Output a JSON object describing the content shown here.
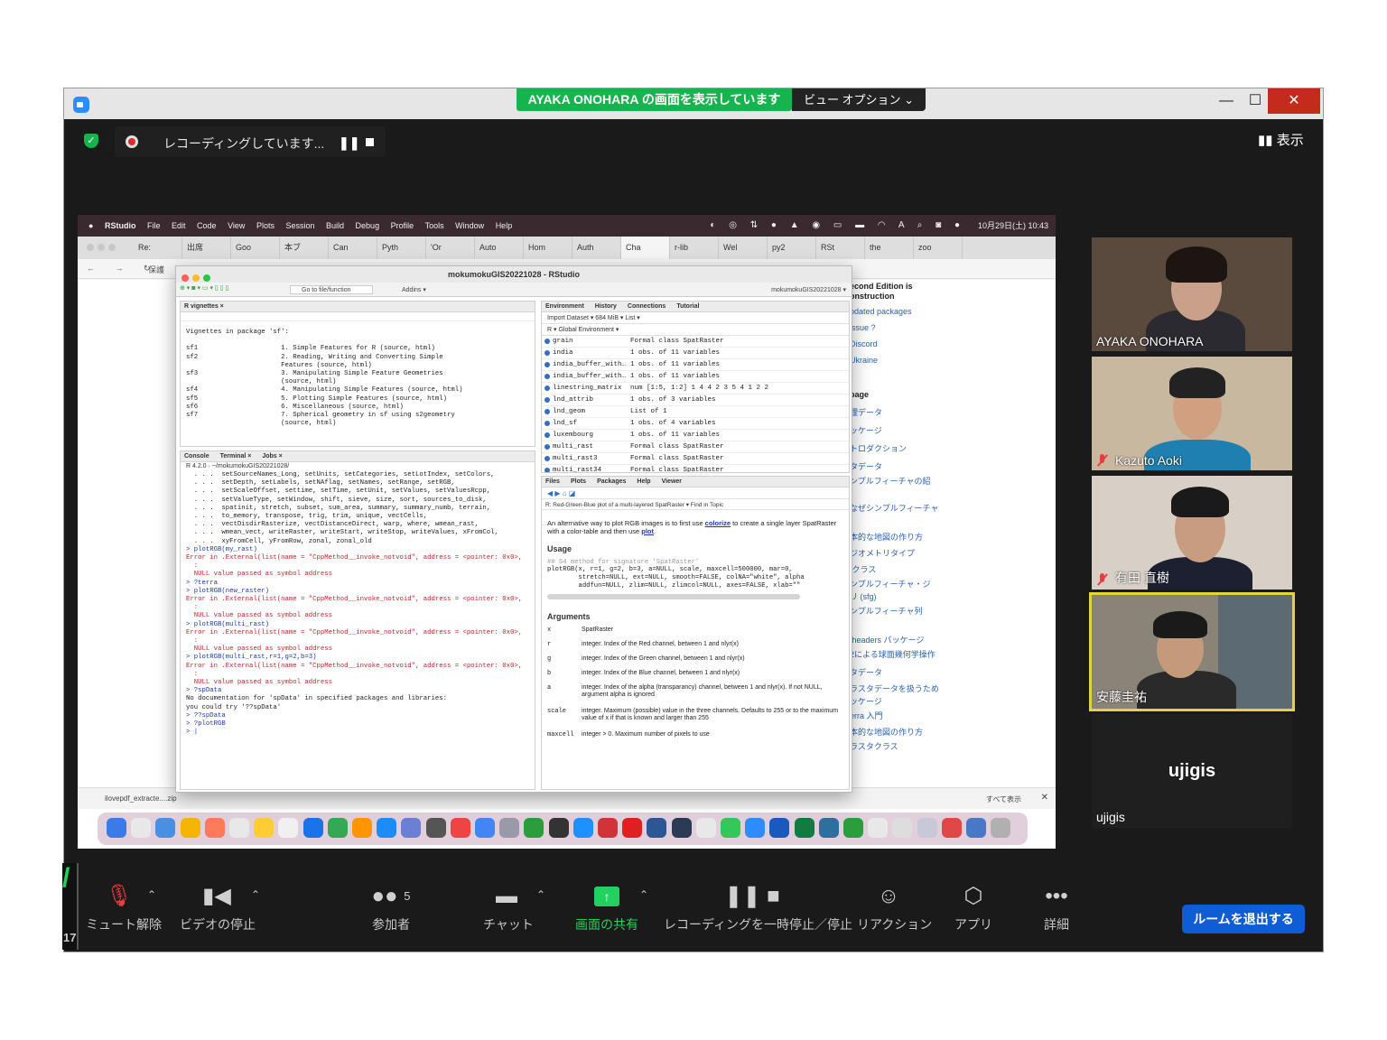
{
  "zoom": {
    "sharing_banner": "AYAKA ONOHARA の画面を表示しています",
    "view_options": "ビュー オプション ⌄",
    "minimize": "—",
    "maximize": "☐",
    "close": "✕",
    "recording_text": "レコーディングしています...",
    "view_toggle": "表示",
    "left_stub_num": "17",
    "left_stub_mark": "/",
    "controls": {
      "mute": "ミュート解除",
      "video": "ビデオの停止",
      "participants": "参加者",
      "participants_count": "5",
      "chat": "チャット",
      "share": "画面の共有",
      "recording": "レコーディングを一時停止／停止",
      "reactions": "リアクション",
      "apps": "アプリ",
      "more": "詳細",
      "leave": "ルームを退出する"
    },
    "participants": [
      {
        "name": "AYAKA ONOHARA",
        "muted": false
      },
      {
        "name": "Kazuto Aoki",
        "muted": true
      },
      {
        "name": "有田 直樹",
        "muted": true
      },
      {
        "name": "安藤圭祐",
        "muted": false,
        "speaking": true
      },
      {
        "name": "ujigis",
        "muted": false
      }
    ],
    "ujigis_center": "ujigis"
  },
  "mac": {
    "menu": [
      "RStudio",
      "File",
      "Edit",
      "Code",
      "View",
      "Plots",
      "Session",
      "Build",
      "Debug",
      "Profile",
      "Tools",
      "Window",
      "Help"
    ],
    "clock": "10月29日(土) 10:43"
  },
  "chrome": {
    "tabs": [
      "Re:",
      "出席",
      "Goo",
      "本ブ",
      "Can",
      "Pyth",
      "'Or",
      "Auto",
      "Hom",
      "Auth",
      "Cha",
      "r-lib",
      "Wel",
      "py2",
      "RSt",
      "the",
      "zoo"
    ],
    "protect_label": "保護",
    "downloads_file": "ilovepdf_extracte....zip",
    "downloads_showall": "すべて表示",
    "sidebar": [
      "econd Edition is",
      "onstruction",
      "pdated packages",
      "issue ?",
      "Discord",
      "Ukraine",
      "page",
      "理データ",
      "ッケージ",
      "トロダクション",
      "タデータ",
      "ンプルフィーチャの紹",
      "なぜシンプルフィーチャ",
      "本的な地図の作り方",
      "ジオメトリタイプ",
      "fクラス",
      "ンプルフィーチャ・ジ",
      "リ (sfg)",
      "ンプルフィーチャ列",
      "fheaders パッケージ",
      "2による球面幾何学操作",
      "タデータ",
      "ラスタデータを扱うため",
      "ッケージ",
      "erra 入門",
      "本的な地図の作り方",
      "ラスタクラス"
    ]
  },
  "rstudio": {
    "title": "mokumokuGIS20221028 - RStudio",
    "goto_placeholder": "Go to file/function",
    "addins": "Addins ▾",
    "project": "mokumokuGIS20221028 ▾",
    "vignettes_tab": "R vignettes ×",
    "vignettes_text": "Vignettes in package 'sf':\n\nsf1                     1. Simple Features for R (source, html)\nsf2                     2. Reading, Writing and Converting Simple\n                        Features (source, html)\nsf3                     3. Manipulating Simple Feature Geometries\n                        (source, html)\nsf4                     4. Manipulating Simple Features (source, html)\nsf5                     5. Plotting Simple Features (source, html)\nsf6                     6. Miscellaneous (source, html)\nsf7                     7. Spherical geometry in sf using s2geometry\n                        (source, html)",
    "console_tabs": [
      "Console",
      "Terminal ×",
      "Jobs ×"
    ],
    "console_path": "R 4.2.0 · ~/mokumokuGIS20221028/",
    "console_lines": [
      {
        "t": "plain",
        "s": "  . . .  setSourceNames_Long, setUnits, setCategories, setLotIndex, setColors,"
      },
      {
        "t": "plain",
        "s": "  . . .  setDepth, setLabels, setNAflag, setNames, setRange, setRGB,"
      },
      {
        "t": "plain",
        "s": "  . . .  setScaleOffset, settime, setTime, setUnit, setValues, setValuesRcpp,"
      },
      {
        "t": "plain",
        "s": "  . . .  setValueType, setWindow, shift, sieve, size, sort, sources_to_disk,"
      },
      {
        "t": "plain",
        "s": "  . . .  spatinit, stretch, subset, sum_area, summary, summary_numb, terrain,"
      },
      {
        "t": "plain",
        "s": "  . . .  to_memory, transpose, trig, trim, unique, vectCells,"
      },
      {
        "t": "plain",
        "s": "  . . .  vectDisdirRasterize, vectDistanceDirect, warp, where, wmean_rast,"
      },
      {
        "t": "plain",
        "s": "  . . .  wmean_vect, writeRaster, writeStart, writeStop, writeValues, xFromCol,"
      },
      {
        "t": "plain",
        "s": "  . . .  xyFromCell, yFromRow, zonal, zonal_old"
      },
      {
        "t": "cmd",
        "s": "> plotRGB(my_rast)"
      },
      {
        "t": "err",
        "s": "Error in .External(list(name = \"CppMethod__invoke_notvoid\", address = <pointer: 0x0>,"
      },
      {
        "t": "err",
        "s": "  :"
      },
      {
        "t": "err",
        "s": "  NULL value passed as symbol address"
      },
      {
        "t": "cmd",
        "s": "> ?terra"
      },
      {
        "t": "cmd",
        "s": "> plotRGB(new_raster)"
      },
      {
        "t": "err",
        "s": "Error in .External(list(name = \"CppMethod__invoke_notvoid\", address = <pointer: 0x0>,"
      },
      {
        "t": "err",
        "s": "  :"
      },
      {
        "t": "err",
        "s": "  NULL value passed as symbol address"
      },
      {
        "t": "cmd",
        "s": "> plotRGB(multi_rast)"
      },
      {
        "t": "err",
        "s": "Error in .External(list(name = \"CppMethod__invoke_notvoid\", address = <pointer: 0x0>,"
      },
      {
        "t": "err",
        "s": "  :"
      },
      {
        "t": "err",
        "s": "  NULL value passed as symbol address"
      },
      {
        "t": "cmd",
        "s": "> plotRGB(multi_rast,r=1,g=2,b=3)"
      },
      {
        "t": "err",
        "s": "Error in .External(list(name = \"CppMethod__invoke_notvoid\", address = <pointer: 0x0>,"
      },
      {
        "t": "err",
        "s": "  :"
      },
      {
        "t": "err",
        "s": "  NULL value passed as symbol address"
      },
      {
        "t": "cmd",
        "s": "> ?spData"
      },
      {
        "t": "plain",
        "s": "No documentation for 'spData' in specified packages and libraries:"
      },
      {
        "t": "plain",
        "s": "you could try '??spData'"
      },
      {
        "t": "cmd",
        "s": "> ??spData"
      },
      {
        "t": "cmd",
        "s": "> ?plotRGB"
      },
      {
        "t": "cmd",
        "s": "> |"
      }
    ],
    "env_tabs": [
      "Environment",
      "History",
      "Connections",
      "Tutorial"
    ],
    "env_toolbar": "Import Dataset ▾   684 MiB ▾                                    List ▾",
    "env_scope": "R ▾   Global Environment ▾",
    "env_rows": [
      {
        "name": "grain",
        "value": "Formal class  SpatRaster"
      },
      {
        "name": "india",
        "value": "1 obs. of 11 variables"
      },
      {
        "name": "india_buffer_with…",
        "value": "1 obs. of 11 variables"
      },
      {
        "name": "india_buffer_with…",
        "value": "1 obs. of 11 variables"
      },
      {
        "name": "linestring_matrix",
        "value": "num [1:5, 1:2] 1 4 4 2 3 5 4 1 2 2"
      },
      {
        "name": "lnd_attrib",
        "value": "1 obs. of 3 variables"
      },
      {
        "name": "lnd_geom",
        "value": "List of  1"
      },
      {
        "name": "lnd_sf",
        "value": "1 obs. of 4 variables"
      },
      {
        "name": "luxembourg",
        "value": "1 obs. of 11 variables"
      },
      {
        "name": "multi_rast",
        "value": "Formal class  SpatRaster"
      },
      {
        "name": "multi_rast3",
        "value": "Formal class  SpatRaster"
      },
      {
        "name": "multi_rast34",
        "value": "Formal class  SpatRaster"
      }
    ],
    "help_tabs": [
      "Files",
      "Plots",
      "Packages",
      "Help",
      "Viewer"
    ],
    "help_topic": "R: Red-Green-Blue plot of a multi-layered SpatRaster ▾     Find in Topic",
    "help_intro_pre": "An alternative way to plot RGB images is to first use ",
    "help_intro_link1": "colorize",
    "help_intro_mid": " to create a single layer SpatRaster with a color-table and then use ",
    "help_intro_link2": "plot",
    "help_intro_end": ".",
    "usage_title": "Usage",
    "usage_comment": "## S4 method for signature 'SpatRaster'",
    "usage_code": "plotRGB(x, r=1, g=2, b=3, a=NULL, scale, maxcell=500000, mar=0,\n        stretch=NULL, ext=NULL, smooth=FALSE, colNA=\"white\", alpha\n        addfun=NULL, zlim=NULL, zlimcol=NULL, axes=FALSE, xlab=\"\"",
    "arguments_title": "Arguments",
    "arguments": [
      {
        "name": "x",
        "desc": "SpatRaster"
      },
      {
        "name": "r",
        "desc": "integer. Index of the Red channel, between 1 and nlyr(x)"
      },
      {
        "name": "g",
        "desc": "integer. Index of the Green channel, between 1 and nlyr(x)"
      },
      {
        "name": "b",
        "desc": "integer. Index of the Blue channel, between 1 and nlyr(x)"
      },
      {
        "name": "a",
        "desc": "integer. Index of the alpha (transparancy) channel, between 1 and nlyr(x). If not NULL, argument alpha is ignored"
      },
      {
        "name": "scale",
        "desc": "integer. Maximum (possible) value in the three channels. Defaults to 255 or to the maximum value of x if that is known and larger than 255"
      },
      {
        "name": "maxcell",
        "desc": "integer > 0. Maximum number of pixels to use"
      }
    ]
  }
}
